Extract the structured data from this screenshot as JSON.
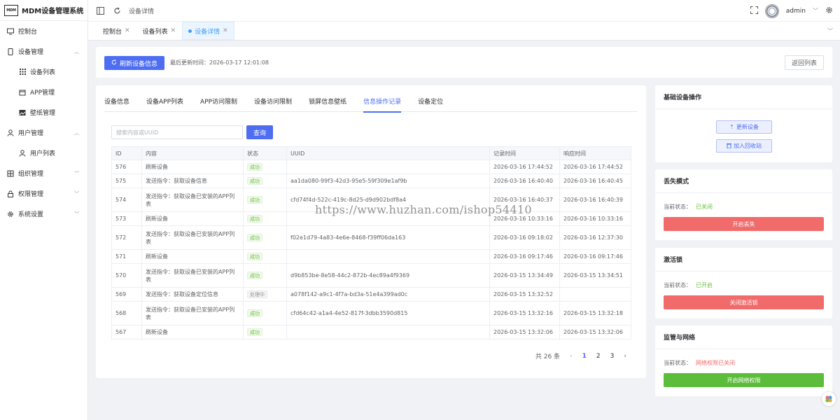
{
  "app": {
    "logo_text": "MDM",
    "title": "MDM设备管理系统"
  },
  "sidebar": {
    "items": [
      {
        "label": "控制台",
        "icon": "monitor-icon"
      },
      {
        "label": "设备管理",
        "icon": "tablet-icon"
      },
      {
        "label": "设备列表",
        "icon": "grid-icon"
      },
      {
        "label": "APP管理",
        "icon": "box-icon"
      },
      {
        "label": "壁纸管理",
        "icon": "image-icon"
      },
      {
        "label": "用户管理",
        "icon": "user-icon"
      },
      {
        "label": "用户列表",
        "icon": "user-icon"
      },
      {
        "label": "组织管理",
        "icon": "org-icon"
      },
      {
        "label": "权限管理",
        "icon": "lock-icon"
      },
      {
        "label": "系统设置",
        "icon": "gear-icon"
      }
    ]
  },
  "header": {
    "breadcrumb": "设备详情",
    "user": "admin"
  },
  "page_tabs": [
    {
      "label": "控制台"
    },
    {
      "label": "设备列表"
    },
    {
      "label": "设备详情",
      "active": true
    }
  ],
  "toolbar": {
    "refresh_label": "刷新设备信息",
    "last_update": "最后更新时间：2026-03-17 12:01:08",
    "back_label": "返回列表"
  },
  "sub_tabs": [
    "设备信息",
    "设备APP列表",
    "APP访问限制",
    "设备访问限制",
    "锁屏信息壁纸",
    "信息操作记录",
    "设备定位"
  ],
  "active_sub_tab": 5,
  "search": {
    "placeholder": "搜索内容或UUID",
    "value": "",
    "button": "查询"
  },
  "table": {
    "headers": [
      "ID",
      "内容",
      "状态",
      "UUID",
      "记录时间",
      "响应时间"
    ],
    "rows": [
      {
        "id": "576",
        "content": "刷新设备",
        "status": "成功",
        "uuid": "",
        "recorded": "2026-03-16 17:44:52",
        "responded": "2026-03-16 17:44:52"
      },
      {
        "id": "575",
        "content": "发送指令：获取设备信息",
        "status": "成功",
        "uuid": "aa1da080-99f3-42d3-95e5-59f309e1af9b",
        "recorded": "2026-03-16 16:40:40",
        "responded": "2026-03-16 16:40:45"
      },
      {
        "id": "574",
        "content": "发送指令：获取设备已安装的APP列表",
        "status": "成功",
        "uuid": "cfd74f4d-522c-419c-8d25-d9d902bdf8a4",
        "recorded": "2026-03-16 16:40:37",
        "responded": "2026-03-16 16:40:39"
      },
      {
        "id": "573",
        "content": "刷新设备",
        "status": "成功",
        "uuid": "",
        "recorded": "2026-03-16 10:33:16",
        "responded": "2026-03-16 10:33:16"
      },
      {
        "id": "572",
        "content": "发送指令：获取设备已安装的APP列表",
        "status": "成功",
        "uuid": "f02e1d79-4a83-4e6e-8468-f39ff06da163",
        "recorded": "2026-03-16 09:18:02",
        "responded": "2026-03-16 12:37:30"
      },
      {
        "id": "571",
        "content": "刷新设备",
        "status": "成功",
        "uuid": "",
        "recorded": "2026-03-16 09:17:46",
        "responded": "2026-03-16 09:17:46"
      },
      {
        "id": "570",
        "content": "发送指令：获取设备已安装的APP列表",
        "status": "成功",
        "uuid": "d9b853be-8e58-44c2-872b-4ec89a4f9369",
        "recorded": "2026-03-15 13:34:49",
        "responded": "2026-03-15 13:34:51"
      },
      {
        "id": "569",
        "content": "发送指令：获取设备定位信息",
        "status": "处理中",
        "uuid": "a078f142-a9c1-4f7a-bd3a-51e4a399ad0c",
        "recorded": "2026-03-15 13:32:52",
        "responded": ""
      },
      {
        "id": "568",
        "content": "发送指令：获取设备已安装的APP列表",
        "status": "成功",
        "uuid": "cfd64c42-a1a4-4e52-817f-3dbb3590d815",
        "recorded": "2026-03-15 13:32:16",
        "responded": "2026-03-15 13:32:18"
      },
      {
        "id": "567",
        "content": "刷新设备",
        "status": "成功",
        "uuid": "",
        "recorded": "2026-03-15 13:32:06",
        "responded": "2026-03-15 13:32:06"
      }
    ]
  },
  "pagination": {
    "total": "共 26 条",
    "pages": [
      "1",
      "2",
      "3"
    ],
    "current": "1"
  },
  "panels": {
    "basic": {
      "title": "基础设备操作",
      "update_label": "更新设备",
      "recycle_label": "加入回收站"
    },
    "lost": {
      "title": "丢失模式",
      "status_label": "当前状态：",
      "status_value": "已关闭",
      "action": "开启丢失"
    },
    "activation": {
      "title": "激活锁",
      "status_label": "当前状态：",
      "status_value": "已开启",
      "action": "关闭激活锁"
    },
    "network": {
      "title": "监管与网络",
      "status_label": "当前状态：",
      "status_value": "网络权限已关闭",
      "action": "开启网络权限"
    }
  },
  "colors": {
    "primary": "#4e6ef2",
    "success": "#67c23a",
    "danger": "#f26b6b",
    "green_button": "#5bbd3a"
  },
  "watermark": "https://www.huzhan.com/ishop54410"
}
